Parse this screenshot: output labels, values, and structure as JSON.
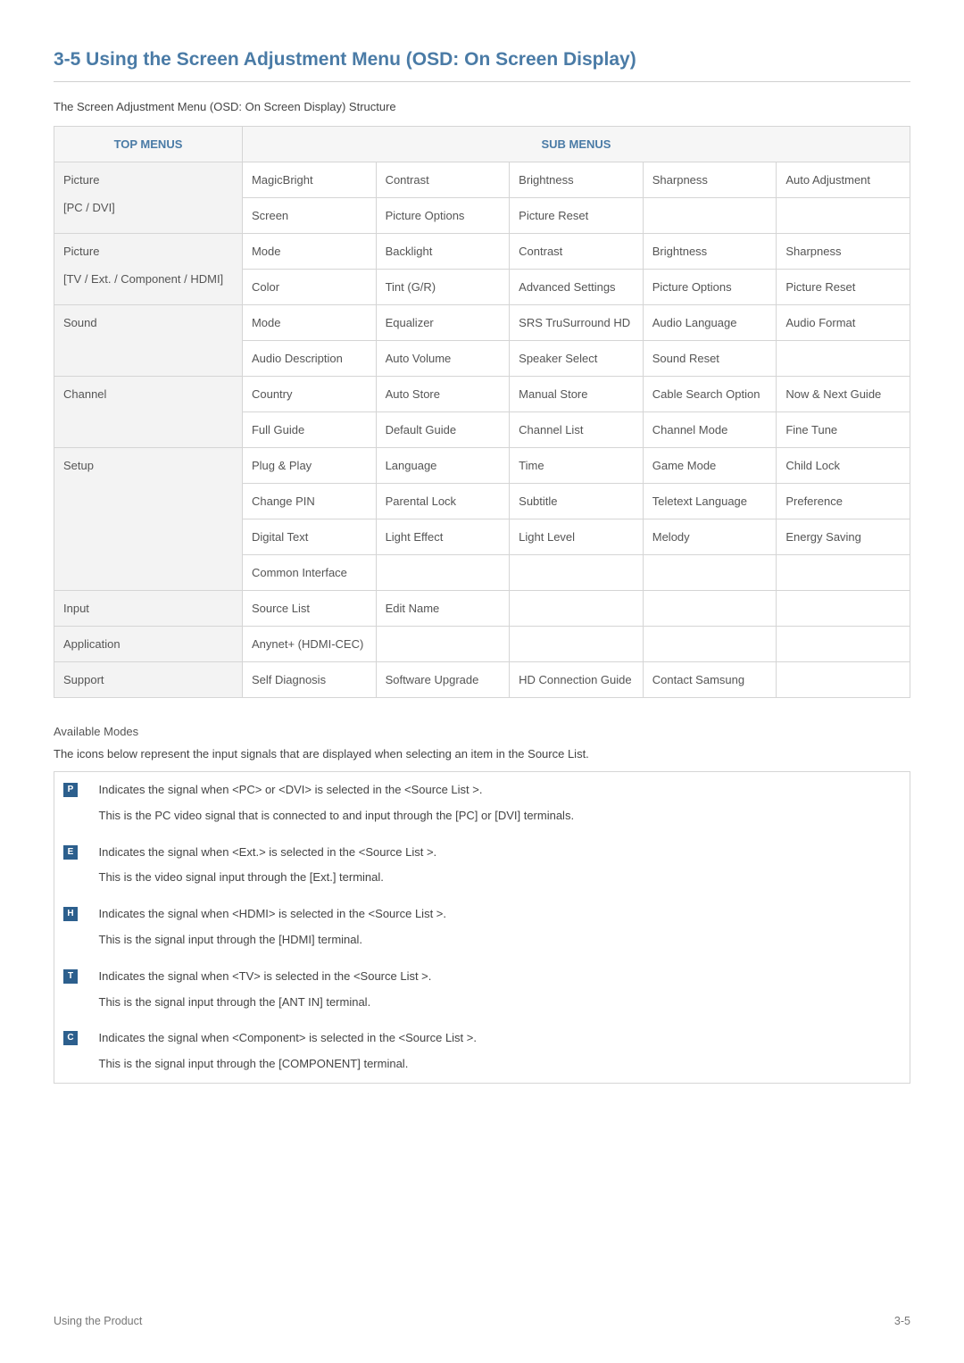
{
  "heading": "3-5    Using the Screen Adjustment Menu (OSD: On Screen Display)",
  "introText": "The Screen Adjustment Menu (OSD: On Screen Display) Structure",
  "headers": {
    "topMenus": "TOP MENUS",
    "subMenus": "SUB MENUS"
  },
  "groups": [
    {
      "top": "Picture\n[PC / DVI]",
      "rows": [
        [
          "MagicBright",
          "Contrast",
          "Brightness",
          "Sharpness",
          "Auto Adjustment"
        ],
        [
          "Screen",
          "Picture Options",
          "Picture Reset",
          "",
          ""
        ]
      ]
    },
    {
      "top": "Picture\n[TV / Ext. / Component / HDMI]",
      "rows": [
        [
          "Mode",
          "Backlight",
          "Contrast",
          "Brightness",
          "Sharpness"
        ],
        [
          "Color",
          "Tint (G/R)",
          "Advanced Settings",
          "Picture Options",
          "Picture Reset"
        ]
      ]
    },
    {
      "top": "Sound",
      "rows": [
        [
          "Mode",
          "Equalizer",
          "SRS TruSurround HD",
          "Audio Language",
          "Audio Format"
        ],
        [
          "Audio Description",
          "Auto Volume",
          "Speaker Select",
          "Sound Reset",
          ""
        ]
      ]
    },
    {
      "top": "Channel",
      "rows": [
        [
          "Country",
          "Auto Store",
          "Manual Store",
          "Cable Search Option",
          "Now & Next Guide"
        ],
        [
          "Full Guide",
          "Default Guide",
          "Channel List",
          "Channel Mode",
          "Fine Tune"
        ]
      ]
    },
    {
      "top": "Setup",
      "rows": [
        [
          "Plug & Play",
          "Language",
          "Time",
          "Game Mode",
          "Child Lock"
        ],
        [
          "Change PIN",
          "Parental Lock",
          "Subtitle",
          "Teletext Language",
          "Preference"
        ],
        [
          "Digital Text",
          "Light Effect",
          "Light Level",
          "Melody",
          "Energy Saving"
        ],
        [
          "Common Interface",
          "",
          "",
          "",
          ""
        ]
      ]
    },
    {
      "top": "Input",
      "rows": [
        [
          "Source List",
          "Edit Name",
          "",
          "",
          ""
        ]
      ]
    },
    {
      "top": "Application",
      "rows": [
        [
          "Anynet+ (HDMI-CEC)",
          "",
          "",
          "",
          ""
        ]
      ]
    },
    {
      "top": "Support",
      "rows": [
        [
          "Self Diagnosis",
          "Software Upgrade",
          "HD Connection Guide",
          "Contact Samsung",
          ""
        ]
      ]
    }
  ],
  "availableModesTitle": "Available Modes",
  "availableModesDesc": "The icons below represent the input signals that are displayed when selecting an item in the Source List.",
  "modes": [
    {
      "icon": "P",
      "line1": "Indicates the signal when <PC> or <DVI> is selected in the <Source List >.",
      "line2": "This is the PC video signal that is connected to and input through the [PC] or [DVI] terminals."
    },
    {
      "icon": "E",
      "line1": "Indicates the signal when <Ext.> is selected in the <Source List >.",
      "line2": "This is the video signal input through the [Ext.] terminal."
    },
    {
      "icon": "H",
      "line1": "Indicates the signal when <HDMI> is selected in the <Source List >.",
      "line2": "This is the signal input through the [HDMI] terminal."
    },
    {
      "icon": "T",
      "line1": "Indicates the signal when <TV> is selected in the <Source List >.",
      "line2": "This is the signal input through the [ANT IN] terminal."
    },
    {
      "icon": "C",
      "line1": "Indicates the signal when <Component> is selected in the <Source List >.",
      "line2": "This is the signal input through the [COMPONENT] terminal."
    }
  ],
  "footer": {
    "left": "Using the Product",
    "right": "3-5"
  }
}
